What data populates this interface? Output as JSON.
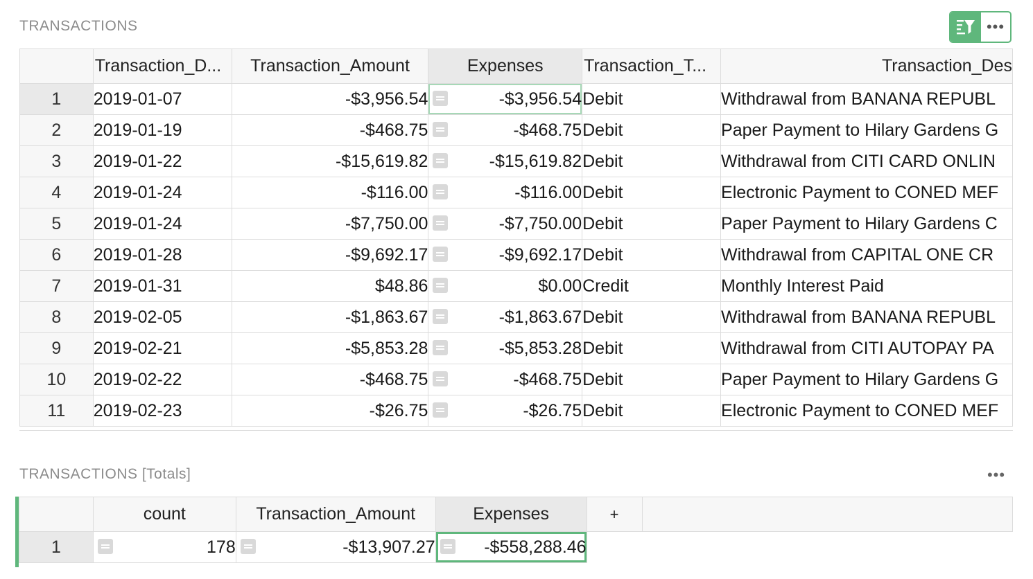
{
  "main_section": {
    "title": "TRANSACTIONS"
  },
  "toolbar": {
    "filter_icon": "sort-filter-icon",
    "more_icon": "more-horizontal-icon",
    "more_label": "•••"
  },
  "columns": [
    {
      "label": "Transaction_D...",
      "align": "left"
    },
    {
      "label": "Transaction_Amount",
      "align": "center"
    },
    {
      "label": "Expenses",
      "align": "center"
    },
    {
      "label": "Transaction_T...",
      "align": "left"
    },
    {
      "label": "Transaction_Des",
      "align": "right"
    }
  ],
  "rows": [
    {
      "num": "1",
      "date": "2019-01-07",
      "amount": "-$3,956.54",
      "expenses": "-$3,956.54",
      "type": "Debit",
      "desc": "Withdrawal from BANANA REPUBL"
    },
    {
      "num": "2",
      "date": "2019-01-19",
      "amount": "-$468.75",
      "expenses": "-$468.75",
      "type": "Debit",
      "desc": "Paper Payment to Hilary Gardens G"
    },
    {
      "num": "3",
      "date": "2019-01-22",
      "amount": "-$15,619.82",
      "expenses": "-$15,619.82",
      "type": "Debit",
      "desc": "Withdrawal from CITI CARD ONLIN"
    },
    {
      "num": "4",
      "date": "2019-01-24",
      "amount": "-$116.00",
      "expenses": "-$116.00",
      "type": "Debit",
      "desc": "Electronic Payment to CONED MEF"
    },
    {
      "num": "5",
      "date": "2019-01-24",
      "amount": "-$7,750.00",
      "expenses": "-$7,750.00",
      "type": "Debit",
      "desc": "Paper Payment to Hilary Gardens C"
    },
    {
      "num": "6",
      "date": "2019-01-28",
      "amount": "-$9,692.17",
      "expenses": "-$9,692.17",
      "type": "Debit",
      "desc": "Withdrawal from CAPITAL ONE CR"
    },
    {
      "num": "7",
      "date": "2019-01-31",
      "amount": "$48.86",
      "expenses": "$0.00",
      "type": "Credit",
      "desc": "Monthly Interest Paid"
    },
    {
      "num": "8",
      "date": "2019-02-05",
      "amount": "-$1,863.67",
      "expenses": "-$1,863.67",
      "type": "Debit",
      "desc": "Withdrawal from BANANA REPUBL"
    },
    {
      "num": "9",
      "date": "2019-02-21",
      "amount": "-$5,853.28",
      "expenses": "-$5,853.28",
      "type": "Debit",
      "desc": "Withdrawal from CITI AUTOPAY PA"
    },
    {
      "num": "10",
      "date": "2019-02-22",
      "amount": "-$468.75",
      "expenses": "-$468.75",
      "type": "Debit",
      "desc": "Paper Payment to Hilary Gardens G"
    },
    {
      "num": "11",
      "date": "2019-02-23",
      "amount": "-$26.75",
      "expenses": "-$26.75",
      "type": "Debit",
      "desc": "Electronic Payment to CONED MEF"
    }
  ],
  "totals_section": {
    "title": "TRANSACTIONS [Totals]",
    "more_label": "•••",
    "columns": [
      "count",
      "Transaction_Amount",
      "Expenses",
      "+"
    ],
    "row": {
      "num": "1",
      "count": "178",
      "amount": "-$13,907.27",
      "expenses": "-$558,288.46"
    }
  },
  "colors": {
    "accent": "#5fb77c",
    "focus_light": "#a7d8b7",
    "header_bg": "#f7f7f7",
    "grid_line": "#dcdcdc"
  }
}
